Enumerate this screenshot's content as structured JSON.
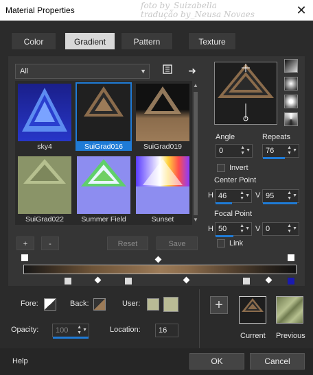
{
  "window": {
    "title": "Material Properties",
    "watermark_line1": "foto by_Suizabella",
    "watermark_line2": "tradução by_Neusa Novaes",
    "close_label": "✕"
  },
  "tabs": [
    {
      "label": "Color",
      "active": false
    },
    {
      "label": "Gradient",
      "active": true
    },
    {
      "label": "Pattern",
      "active": false
    },
    {
      "label": "Texture",
      "active": false
    }
  ],
  "gallery": {
    "category": "All",
    "items": [
      {
        "label": "sky4",
        "selected": false
      },
      {
        "label": "SuiGrad016",
        "selected": true
      },
      {
        "label": "SuiGrad019",
        "selected": false
      },
      {
        "label": "SuiGrad022",
        "selected": false
      },
      {
        "label": "Summer Field",
        "selected": false
      },
      {
        "label": "Sunset",
        "selected": false
      }
    ]
  },
  "editor_buttons": {
    "add": "+",
    "remove": "-",
    "reset": "Reset",
    "save": "Save"
  },
  "settings": {
    "angle_label": "Angle",
    "angle_value": "0",
    "repeats_label": "Repeats",
    "repeats_value": "76",
    "invert_label": "Invert",
    "center_point_label": "Center Point",
    "center_h_label": "H",
    "center_h_value": "46",
    "center_v_label": "V",
    "center_v_value": "95",
    "focal_point_label": "Focal Point",
    "focal_h_label": "H",
    "focal_h_value": "50",
    "focal_v_label": "V",
    "focal_v_value": "0",
    "link_label": "Link"
  },
  "stops_panel": {
    "fore_label": "Fore:",
    "back_label": "Back:",
    "user_label": "User:",
    "opacity_label": "Opacity:",
    "opacity_value": "100",
    "location_label": "Location:",
    "location_value": "16"
  },
  "preview": {
    "add_label": "+",
    "current_label": "Current",
    "previous_label": "Previous"
  },
  "footer": {
    "help_label": "Help",
    "ok_label": "OK",
    "cancel_label": "Cancel"
  },
  "colors": {
    "accent": "#1f7bd6",
    "brown": "#8b6c4c",
    "olive": "#9aa57a"
  }
}
